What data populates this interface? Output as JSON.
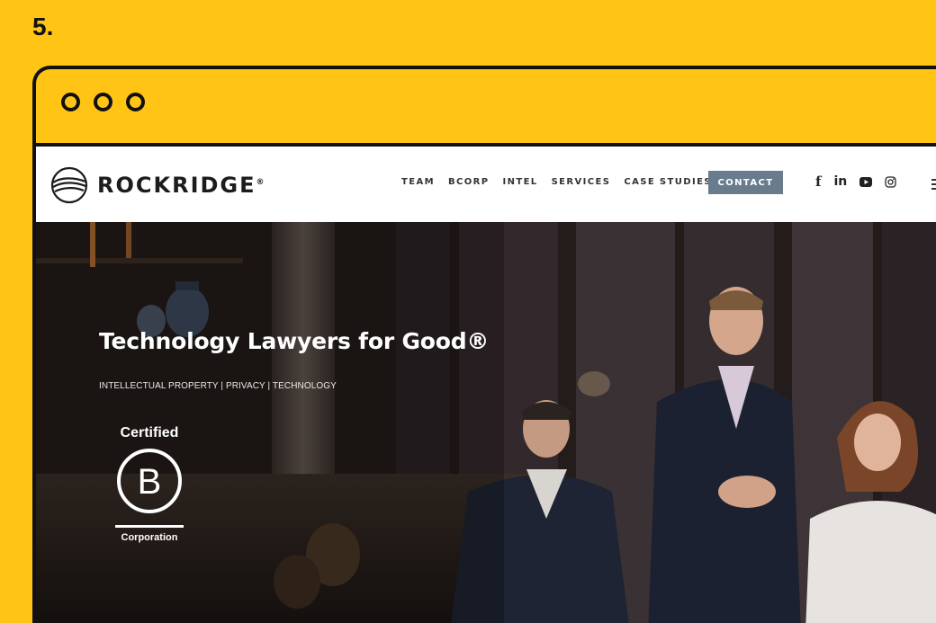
{
  "step": {
    "number": "5."
  },
  "site": {
    "brand": {
      "name": "ROCKRIDGE",
      "reg": "®"
    },
    "nav": [
      {
        "label": "TEAM"
      },
      {
        "label": "BCORP"
      },
      {
        "label": "INTEL"
      },
      {
        "label": "SERVICES"
      },
      {
        "label": "CASE STUDIES"
      }
    ],
    "contact_label": "CONTACT",
    "social": {
      "facebook": "f",
      "linkedin": "in",
      "youtube_icon": "youtube-icon",
      "instagram_icon": "instagram-icon"
    },
    "hero": {
      "title": "Technology Lawyers for Good®",
      "subtitle": "INTELLECTUAL PROPERTY | PRIVACY | TECHNOLOGY"
    },
    "bcorp": {
      "certified": "Certified",
      "letter": "B",
      "reg": "®",
      "corporation": "Corporation"
    }
  },
  "colors": {
    "background": "#FFC414",
    "frame": "#111111",
    "contact_button": "#687C8E"
  }
}
